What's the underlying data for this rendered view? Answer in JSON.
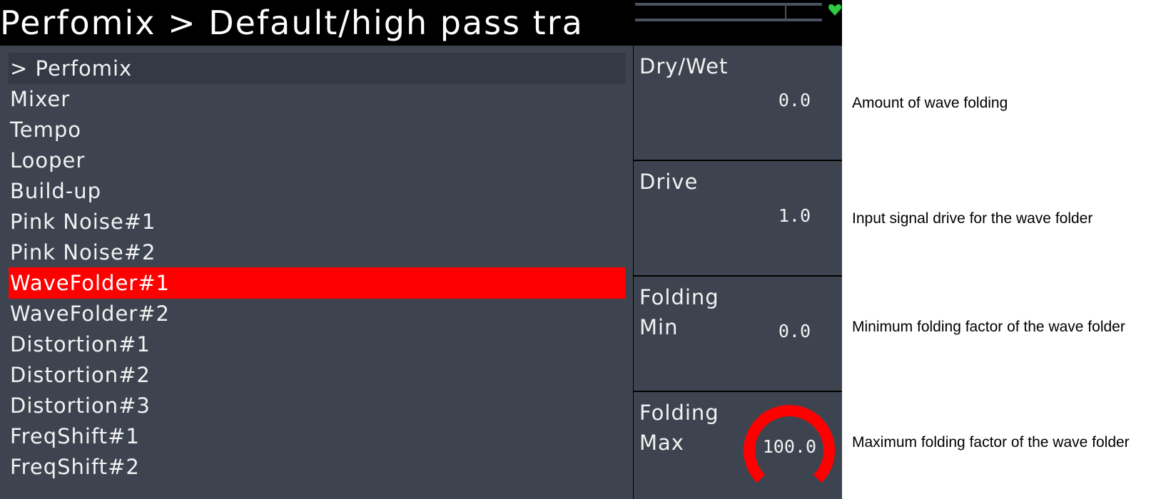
{
  "title": "Perfomix > Default/high pass tra",
  "menu": {
    "items": [
      {
        "label": "> Perfomix",
        "state": "header"
      },
      {
        "label": "Mixer",
        "state": "normal"
      },
      {
        "label": "Tempo",
        "state": "normal"
      },
      {
        "label": "Looper",
        "state": "normal"
      },
      {
        "label": "Build-up",
        "state": "normal"
      },
      {
        "label": "Pink Noise#1",
        "state": "normal"
      },
      {
        "label": "Pink Noise#2",
        "state": "normal"
      },
      {
        "label": "WaveFolder#1",
        "state": "selected"
      },
      {
        "label": "WaveFolder#2",
        "state": "normal"
      },
      {
        "label": "Distortion#1",
        "state": "normal"
      },
      {
        "label": "Distortion#2",
        "state": "normal"
      },
      {
        "label": "Distortion#3",
        "state": "normal"
      },
      {
        "label": "FreqShift#1",
        "state": "normal"
      },
      {
        "label": "FreqShift#2",
        "state": "normal"
      }
    ]
  },
  "params": [
    {
      "name": "Dry/Wet",
      "value": "0.0",
      "active": false,
      "knob_fraction": 0.0,
      "description": "Amount of wave folding"
    },
    {
      "name": "Drive",
      "value": "1.0",
      "active": false,
      "knob_fraction": 0.0,
      "description": "Input signal drive for the wave folder"
    },
    {
      "name": "Folding\nMin",
      "value": "0.0",
      "active": false,
      "knob_fraction": 0.0,
      "description": "Minimum folding factor of the wave folder"
    },
    {
      "name": "Folding\nMax",
      "value": "100.0",
      "active": true,
      "knob_fraction": 1.0,
      "description": "Maximum folding factor of the wave folder"
    }
  ],
  "colors": {
    "panel": "#3d4450",
    "selected": "#ff0000",
    "knob": "#ff0000",
    "status": "#2ecc40"
  },
  "icons": {
    "status": "heart-icon"
  }
}
